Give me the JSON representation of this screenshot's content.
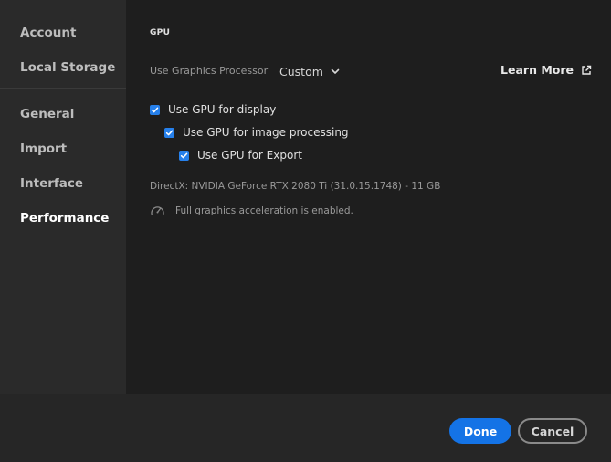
{
  "sidebar": {
    "groups": [
      {
        "items": [
          {
            "label": "Account"
          },
          {
            "label": "Local Storage"
          }
        ]
      },
      {
        "items": [
          {
            "label": "General"
          },
          {
            "label": "Import"
          },
          {
            "label": "Interface"
          },
          {
            "label": "Performance",
            "active": true
          }
        ]
      }
    ]
  },
  "content": {
    "section_title": "GPU",
    "graphics_processor": {
      "label": "Use Graphics Processor",
      "selected": "Custom"
    },
    "learn_more": "Learn More",
    "checkboxes": [
      {
        "label": "Use GPU for display",
        "checked": true
      },
      {
        "label": "Use GPU for image processing",
        "checked": true
      },
      {
        "label": "Use GPU for Export",
        "checked": true
      }
    ],
    "directx_info": "DirectX: NVIDIA GeForce RTX 2080 Ti (31.0.15.1748) - 11 GB",
    "acceleration_status": "Full graphics acceleration is enabled."
  },
  "footer": {
    "done_label": "Done",
    "cancel_label": "Cancel"
  },
  "colors": {
    "accent": "#1473e6",
    "checkbox": "#2680eb"
  }
}
